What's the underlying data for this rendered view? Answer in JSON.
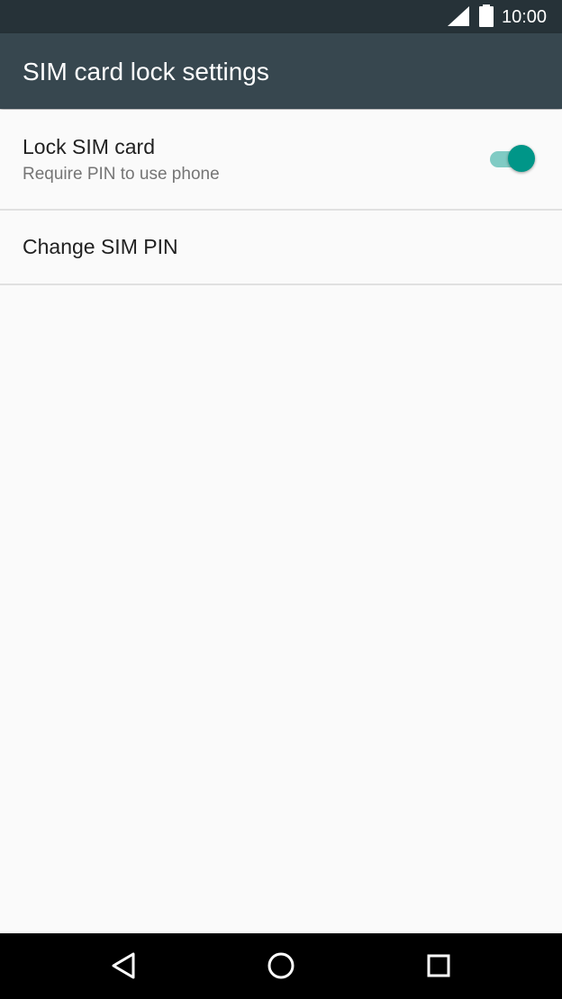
{
  "status_bar": {
    "time": "10:00",
    "icons": [
      "signal-icon",
      "battery-icon"
    ]
  },
  "app_bar": {
    "title": "SIM card lock settings"
  },
  "preferences": [
    {
      "title": "Lock SIM card",
      "summary": "Require PIN to use phone",
      "toggle": {
        "checked": true
      }
    },
    {
      "title": "Change SIM PIN"
    }
  ],
  "nav_bar": {
    "buttons": [
      "back-icon",
      "home-icon",
      "recents-icon"
    ]
  },
  "colors": {
    "status_bar": "#263238",
    "app_bar": "#37474f",
    "accent": "#009688",
    "accent_track": "#80cbc4",
    "background": "#fafafa",
    "divider": "#e0e0e0",
    "primary_text": "#212121",
    "secondary_text": "#757575",
    "nav_bar": "#000000"
  }
}
